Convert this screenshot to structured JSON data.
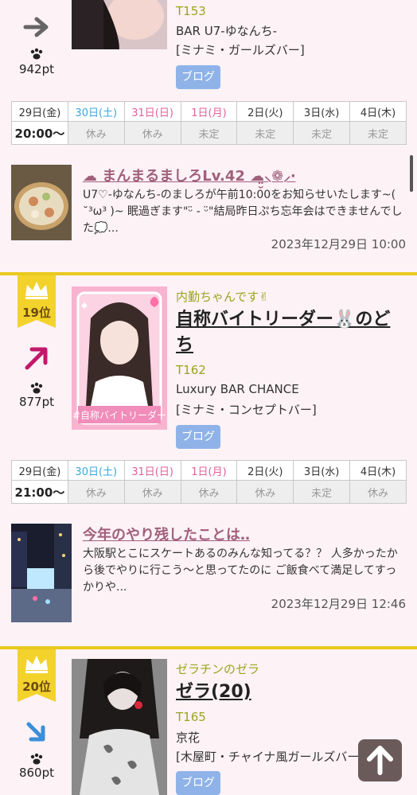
{
  "entries": [
    {
      "rank": "",
      "trend": "flat",
      "points": "942pt",
      "catch": "",
      "name": "",
      "tno": "T153",
      "shop": "BAR U7-ゆなんち-",
      "area": "[ミナミ・ガールズバー]",
      "blog_label": "ブログ",
      "schedule": {
        "days": [
          "29日(金)",
          "30日(土)",
          "31日(日)",
          "1日(月)",
          "2日(火)",
          "3日(水)",
          "4日(木)"
        ],
        "day_colors": [
          "wkd",
          "sat",
          "hol",
          "hol",
          "wkd",
          "wkd",
          "wkd"
        ],
        "status": [
          "20:00〜",
          "休み",
          "休み",
          "未定",
          "未定",
          "未定",
          "未定"
        ]
      },
      "post": {
        "title": "☁ まんまるましろLv.42 ☁̤̮⸜❁⸝‧",
        "body": "U7♡-ゆなんち-のましろが午前10:00をお知らせいたします~( ˘³ω³ )~ 眠過ぎます\"ᵕ̈ - ᵕ̈\"結局昨日ぷち忘年会はできませんでした💭...",
        "date": "2023年12月29日 10:00"
      }
    },
    {
      "rank": "19位",
      "trend": "up",
      "points": "877pt",
      "catch": "内勤ちゃんです✌",
      "name": "自称バイトリーダー🐰のどち",
      "tno": "T162",
      "shop": "Luxury BAR CHANCE",
      "area": "[ミナミ・コンセプトバー]",
      "blog_label": "ブログ",
      "photo_caption": "#自称バイトリーダー",
      "schedule": {
        "days": [
          "29日(金)",
          "30日(土)",
          "31日(日)",
          "1日(月)",
          "2日(火)",
          "3日(水)",
          "4日(木)"
        ],
        "day_colors": [
          "wkd",
          "sat",
          "hol",
          "hol",
          "wkd",
          "wkd",
          "wkd"
        ],
        "status": [
          "21:00〜",
          "休み",
          "休み",
          "休み",
          "休み",
          "未定",
          "休み"
        ]
      },
      "post": {
        "title": "今年のやり残したことは‥",
        "body": "大阪駅とこにスケートあるのみんな知ってる？？ 人多かったから後でやりに行こう〜と思ってたのに ご飯食べて満足してすっかりや...",
        "date": "2023年12月29日 12:46"
      }
    },
    {
      "rank": "20位",
      "trend": "down",
      "points": "860pt",
      "catch": "ゼラチンのゼラ",
      "name": "ゼラ(20)",
      "tno": "T165",
      "shop": "京花",
      "area": "[木屋町・チャイナ風ガールズバー]",
      "blog_label": "ブログ"
    }
  ],
  "colors": {
    "accent_gold": "#e9c91f",
    "blog_button": "#8fb3e8",
    "trend_up": "#c2186b",
    "trend_down": "#3a8fd8"
  }
}
